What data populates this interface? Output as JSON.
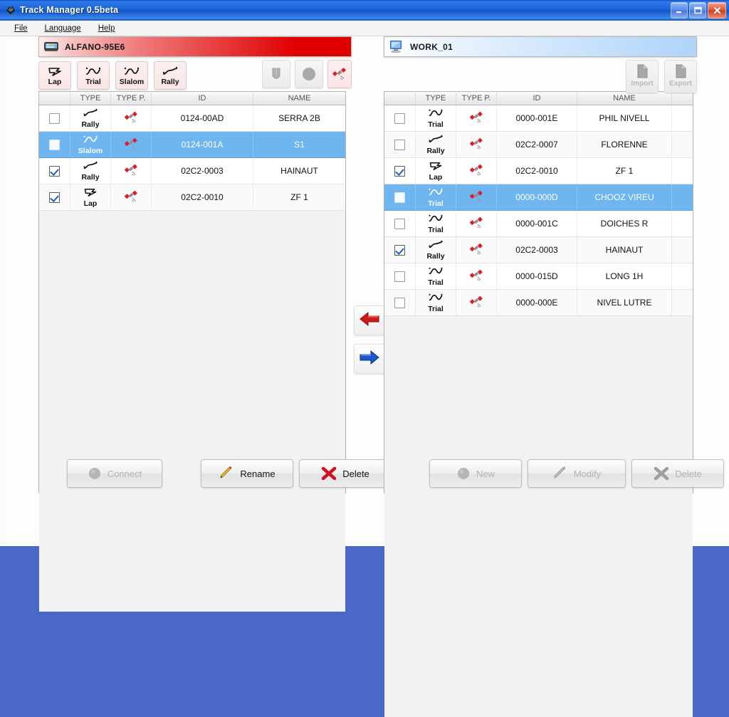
{
  "window": {
    "title": "Track Manager 0.5beta",
    "icon": "app-icon",
    "controls": {
      "minimize": "minimize",
      "maximize": "maximize",
      "close": "close"
    }
  },
  "menubar": {
    "items": [
      {
        "label": "File",
        "mnemonic": "F"
      },
      {
        "label": "Language",
        "mnemonic": "L"
      },
      {
        "label": "Help",
        "mnemonic": "H"
      }
    ]
  },
  "left_panel": {
    "header": {
      "label": "ALFANO-95E6",
      "icon": "device-icon",
      "accent": "#e10000"
    },
    "toolbar": {
      "buttons": [
        {
          "label": "Lap",
          "icon": "lap-icon",
          "enabled": true
        },
        {
          "label": "Trial",
          "icon": "trial-icon",
          "enabled": true
        },
        {
          "label": "Slalom",
          "icon": "slalom-icon",
          "enabled": true
        },
        {
          "label": "Rally",
          "icon": "rally-icon",
          "enabled": true
        }
      ],
      "right_buttons": [
        {
          "label": "",
          "icon": "magnet-icon",
          "enabled": false
        },
        {
          "label": "",
          "icon": "circle-icon",
          "enabled": false
        },
        {
          "label": "",
          "icon": "satellite-icon",
          "enabled": true
        }
      ]
    },
    "table": {
      "columns": [
        "",
        "TYPE",
        "TYPE P.",
        "ID",
        "NAME"
      ],
      "rows": [
        {
          "checked": false,
          "type": "Rally",
          "type_icon": "rally-icon",
          "typep_icon": "satellite-icon",
          "id": "0124-00AD",
          "name": "SERRA 2B",
          "selected": false
        },
        {
          "checked": false,
          "type": "Slalom",
          "type_icon": "slalom-icon",
          "typep_icon": "satellite-icon",
          "id": "0124-001A",
          "name": "S1",
          "selected": true
        },
        {
          "checked": true,
          "type": "Rally",
          "type_icon": "rally-icon",
          "typep_icon": "satellite-icon",
          "id": "02C2-0003",
          "name": "HAINAUT",
          "selected": false
        },
        {
          "checked": true,
          "type": "Lap",
          "type_icon": "lap-icon",
          "typep_icon": "satellite-icon",
          "id": "02C2-0010",
          "name": "ZF 1",
          "selected": false
        }
      ]
    },
    "actions": [
      {
        "label": "Connect",
        "icon": "connect-icon",
        "enabled": false
      },
      {
        "label": "Rename",
        "icon": "pencil-icon",
        "enabled": true
      },
      {
        "label": "Delete",
        "icon": "cross-icon",
        "enabled": true
      }
    ]
  },
  "right_panel": {
    "header": {
      "label": "WORK_01",
      "icon": "computer-icon",
      "accent": "#b0d4f9"
    },
    "toolbar": {
      "right_buttons": [
        {
          "label": "Import",
          "icon": "import-icon",
          "enabled": false
        },
        {
          "label": "Export",
          "icon": "export-icon",
          "enabled": false
        }
      ]
    },
    "table": {
      "columns": [
        "",
        "TYPE",
        "TYPE P.",
        "ID",
        "NAME",
        ""
      ],
      "rows": [
        {
          "checked": false,
          "type": "Trial",
          "type_icon": "trial-icon",
          "typep_icon": "satellite-icon",
          "id": "0000-001E",
          "name": "PHIL NIVELL",
          "selected": false
        },
        {
          "checked": false,
          "type": "Rally",
          "type_icon": "rally-icon",
          "typep_icon": "satellite-icon",
          "id": "02C2-0007",
          "name": "FLORENNE",
          "selected": false
        },
        {
          "checked": true,
          "type": "Lap",
          "type_icon": "lap-icon",
          "typep_icon": "satellite-icon",
          "id": "02C2-0010",
          "name": "ZF 1",
          "selected": false
        },
        {
          "checked": false,
          "type": "Trial",
          "type_icon": "trial-icon",
          "typep_icon": "satellite-icon",
          "id": "0000-000D",
          "name": "CHOOZ VIREU",
          "selected": true
        },
        {
          "checked": false,
          "type": "Trial",
          "type_icon": "trial-icon",
          "typep_icon": "satellite-icon",
          "id": "0000-001C",
          "name": "DOICHES R",
          "selected": false
        },
        {
          "checked": true,
          "type": "Rally",
          "type_icon": "rally-icon",
          "typep_icon": "satellite-icon",
          "id": "02C2-0003",
          "name": "HAINAUT",
          "selected": false
        },
        {
          "checked": false,
          "type": "Trial",
          "type_icon": "trial-icon",
          "typep_icon": "satellite-icon",
          "id": "0000-015D",
          "name": "LONG 1H",
          "selected": false
        },
        {
          "checked": false,
          "type": "Trial",
          "type_icon": "trial-icon",
          "typep_icon": "satellite-icon",
          "id": "0000-000E",
          "name": "NIVEL LUTRE",
          "selected": false
        }
      ]
    },
    "actions": [
      {
        "label": "New",
        "icon": "new-icon",
        "enabled": false
      },
      {
        "label": "Modify",
        "icon": "pencil-icon",
        "enabled": false
      },
      {
        "label": "Delete",
        "icon": "cross-icon",
        "enabled": false
      }
    ]
  },
  "transfer": {
    "to_left": {
      "icon": "arrow-left-icon",
      "color": "#cc1111"
    },
    "to_right": {
      "icon": "arrow-right-icon",
      "color": "#1155cc"
    }
  }
}
